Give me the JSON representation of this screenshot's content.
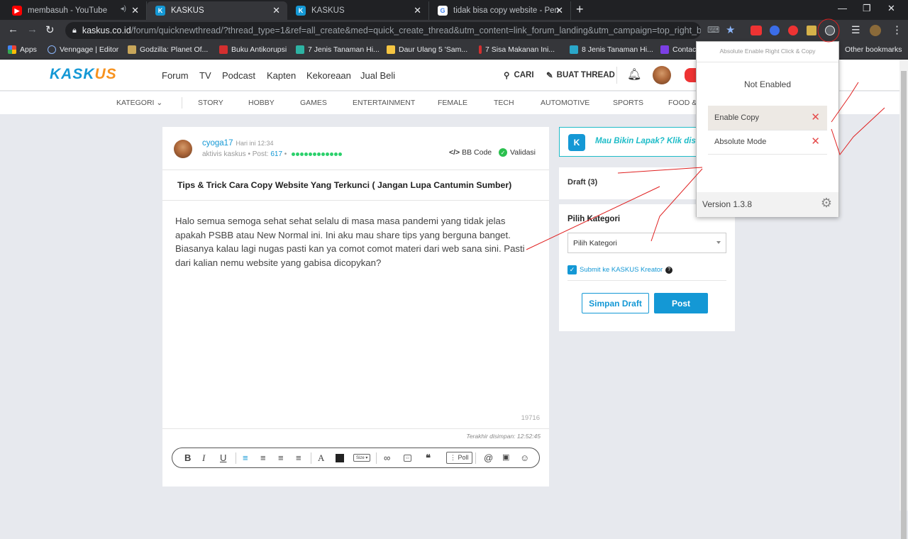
{
  "browser": {
    "tabs": [
      {
        "title": "membasuh - YouTube",
        "favicon": "youtube-icon"
      },
      {
        "title": "KASKUS",
        "favicon": "kaskus-icon"
      },
      {
        "title": "KASKUS",
        "favicon": "kaskus-icon"
      },
      {
        "title": "tidak bisa copy website - Penelus",
        "favicon": "google-icon"
      }
    ],
    "url_host": "kaskus.co.id",
    "url_path": "/forum/quicknewthread/?thread_type=1&ref=all_create&med=quick_create_thread&utm_content=link_forum_landing&utm_campaign=top_right_button",
    "bookmarks": [
      "Apps",
      "Venngage | Editor",
      "Godzilla: Planet Of...",
      "Buku Antikorupsi",
      "7 Jenis Tanaman Hi...",
      "Daur Ulang 5 'Sam...",
      "7 Sisa Makanan Ini...",
      "8 Jenis Tanaman Hi...",
      "Contac"
    ],
    "other_bookmarks": "Other bookmarks"
  },
  "header": {
    "logo_ka": "KASK",
    "logo_us": "US",
    "nav": [
      "Forum",
      "TV",
      "Podcast",
      "Kapten",
      "Kekoreaan",
      "Jual Beli"
    ],
    "search": "CARI",
    "create_thread": "BUAT THREAD"
  },
  "categories": [
    "KATEGORI",
    "STORY",
    "HOBBY",
    "GAMES",
    "ENTERTAINMENT",
    "FEMALE",
    "TECH",
    "AUTOMOTIVE",
    "SPORTS",
    "FOOD & T"
  ],
  "editor": {
    "username": "cyoga17",
    "time": "Hari ini 12:34",
    "role": "aktivis kaskus",
    "post_label": "Post:",
    "post_count": "617",
    "bbcode": "BB Code",
    "validasi": "Validasi",
    "title": "Tips & Trick Cara Copy Website Yang Terkunci ( Jangan Lupa Cantumin Sumber)",
    "body": "Halo semua semoga sehat sehat selalu di masa masa pandemi yang tidak jelas apakah PSBB atau New Normal ini. Ini aku mau share tips yang berguna banget. Biasanya kalau lagi nugas pasti kan ya comot comot materi dari web sana sini. Pasti dari kalian nemu website yang gabisa dicopykan?",
    "char_count": "19716",
    "last_saved": "Terakhir disimpan: 12:52:45",
    "toolbar": {
      "size": "Size",
      "poll": "Poll"
    }
  },
  "sidebar": {
    "promo": "Mau Bikin Lapak? Klik disini",
    "draft": "Draft (3)",
    "kategori_title": "Pilih Kategori",
    "kategori_select": "Pilih Kategori",
    "submit_kreator": "Submit ke KASKUS Kreator",
    "save_draft": "Simpan Draft",
    "post": "Post"
  },
  "popup": {
    "header": "Absolute Enable Right Click & Copy",
    "status": "Not Enabled",
    "items": [
      {
        "label": "Enable Copy"
      },
      {
        "label": "Absolute Mode"
      }
    ],
    "version": "Version 1.3.8"
  },
  "colors": {
    "kaskus_blue": "#1498d5",
    "kaskus_orange": "#f7921e",
    "toggle_off": "#e54b4b",
    "annotation": "#e02020"
  }
}
